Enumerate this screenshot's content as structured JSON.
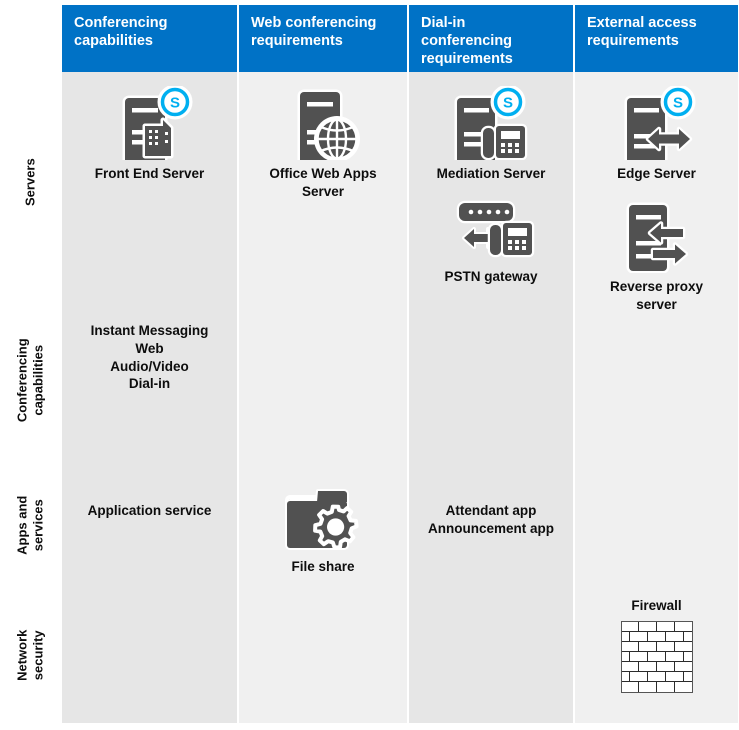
{
  "theme": {
    "header_blue": "#0072c6",
    "column_shade_a": "#e6e6e6",
    "column_shade_b": "#f0f0f0",
    "icon_gray": "#515151",
    "skype_blue": "#00aff0",
    "text_color": "#0d0d0d"
  },
  "row_labels": [
    {
      "id": "servers",
      "text": "Servers"
    },
    {
      "id": "conferencing-capabilities",
      "text": "Conferencing\ncapabilities"
    },
    {
      "id": "apps-and-services",
      "text": "Apps and\nservices"
    },
    {
      "id": "network-security",
      "text": "Network\nsecurity"
    }
  ],
  "columns": [
    {
      "id": "conferencing-capabilities",
      "header": "Conferencing\ncapabilities",
      "servers": [
        {
          "label": "Front End Server",
          "icon": "server-skype-building-icon"
        }
      ],
      "capabilities": "Instant Messaging\nWeb\nAudio/Video\nDial-in",
      "apps": [
        {
          "label": "Application service",
          "icon": "none"
        }
      ],
      "security": []
    },
    {
      "id": "web-conferencing-requirements",
      "header": "Web conferencing\nrequirements",
      "servers": [
        {
          "label": "Office Web Apps\nServer",
          "icon": "server-globe-icon"
        }
      ],
      "capabilities": "",
      "apps": [
        {
          "label": "File share",
          "icon": "folder-gear-icon"
        }
      ],
      "security": []
    },
    {
      "id": "dial-in-conferencing-requirements",
      "header": "Dial-in\nconferencing\nrequirements",
      "servers": [
        {
          "label": "Mediation Server",
          "icon": "server-skype-phone-icon"
        },
        {
          "label": "PSTN gateway",
          "icon": "gateway-phone-icon"
        }
      ],
      "capabilities": "",
      "apps": [
        {
          "label": "Attendant app\nAnnouncement app",
          "icon": "none"
        }
      ],
      "security": []
    },
    {
      "id": "external-access-requirements",
      "header": "External access\nrequirements",
      "servers": [
        {
          "label": "Edge Server",
          "icon": "server-skype-arrows-icon"
        },
        {
          "label": "Reverse proxy\nserver",
          "icon": "server-reverse-arrows-icon"
        }
      ],
      "capabilities": "",
      "apps": [],
      "security": [
        {
          "label": "Firewall",
          "icon": "brick-wall-icon"
        }
      ]
    }
  ]
}
